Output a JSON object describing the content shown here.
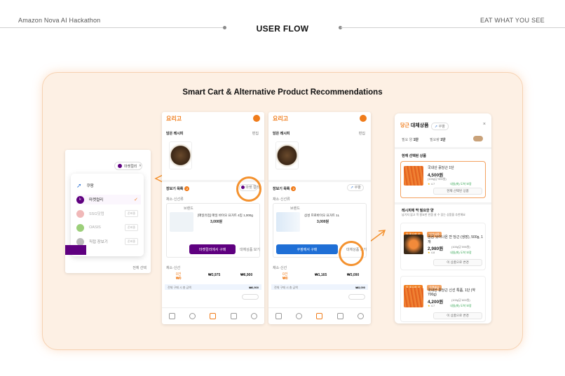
{
  "header": {
    "left": "Amazon Nova AI Hackathon",
    "center": "USER FLOW",
    "right": "EAT WHAT YOU SEE"
  },
  "panel": {
    "title": "Smart Cart & Alternative Product Recommendations"
  },
  "colors": {
    "accent": "#f07c1b",
    "kurly_purple": "#5f0080",
    "blue_cta": "#1f6fd6",
    "panel_bg": "#fdf0e4"
  },
  "dropdown": {
    "button": "마켓컬리",
    "items": [
      {
        "label": "쿠팡",
        "icon": "rocket-icon"
      },
      {
        "label": "마켓컬리",
        "icon": "kurly-logo",
        "selected": true
      },
      {
        "label": "SSG닷컴",
        "tag": "준비중"
      },
      {
        "label": "OASIS",
        "tag": "준비중"
      },
      {
        "label": "직접 장보기",
        "tag": "준비중"
      }
    ],
    "footer": "전체 선택"
  },
  "screen_kurly": {
    "logo": "요리고",
    "recipe_section": "담은 레시피",
    "recipe_edit": "편집",
    "cart_section": "장보기 목록",
    "cart_count": "2",
    "store_chip": "마켓 컬리",
    "cat1": "채소·신선류",
    "prod_brand": "브랜드",
    "prod_name": "[매일유업] 매일 바이오 요거트 4입 1,000g",
    "prod_price": "3,000원",
    "cta": "마켓컬리에서 구매",
    "alt_btn": "대체상품 보기",
    "cat2": "채소·신선",
    "totals": [
      {
        "label": "0건",
        "value": "₩0"
      },
      {
        "label": "",
        "value": "₩3,975"
      },
      {
        "label": "",
        "value": "₩6,900"
      }
    ],
    "info": "전체 구매 시 총 금액",
    "info_val": "₩6,900"
  },
  "screen_coupang": {
    "logo": "요리고",
    "recipe_section": "담은 레시피",
    "recipe_edit": "편집",
    "cart_section": "장보기 목록",
    "cart_count": "2",
    "store_chip": "쿠팡",
    "cat1": "채소·신선류",
    "prod_brand": "브랜드",
    "prod_name": "삼성 프로바이오 요거트 1L",
    "prod_price": "3,000원",
    "cta": "쿠팡에서 구매",
    "alt_btn": "대체상품 보기",
    "cat2": "채소·신선",
    "totals": [
      {
        "label": "0건",
        "value": "₩0"
      },
      {
        "label": "",
        "value": "₩1,165"
      },
      {
        "label": "",
        "value": "₩3,090"
      }
    ],
    "info": "전체 구매 시 총 금액",
    "info_val": "₩3,090"
  },
  "alt_panel": {
    "title_main": "대체상품",
    "title_accent": "당근",
    "store_chip": "쿠팡",
    "meta_need": "필요 양",
    "meta_need_val": "1단",
    "meta_have": "필요량",
    "meta_have_val": "1단",
    "current_section": "현재 선택된 상품",
    "current": {
      "name": "국내산 흙당근 1단",
      "price": "4,500원",
      "unit": "(100g당 900원)",
      "rating": "4.7",
      "delivery": "내일(화) 도착 보장",
      "button": "현재 선택된 상품"
    },
    "recommend_section": "레시피에 딱 필요한 양",
    "recommend_sub": "남기지 않고 딱 필요한 만큼 살 수 있는 상품을 추천해요",
    "products": [
      {
        "tags": [
          "딱 필요한 양",
          "신선식품"
        ],
        "name": "곰곰 씻어나온 깐 당근 (냉장), 500g, 1개",
        "price": "2,980원",
        "unit": "(100g당 596원)",
        "rating": "4.8",
        "delivery": "내일(화) 도착 보장",
        "button": "이 상품으로 변경"
      },
      {
        "tags": [
          "딱 필요한 양",
          "로켓배송"
        ],
        "name": "국내산 흙당근 신선 특품, 1단 (약 700g)",
        "price": "4,200원",
        "unit": "(100g당 600원)",
        "rating": "4.7",
        "delivery": "내일(화) 도착 보장",
        "button": "이 상품으로 변경"
      }
    ]
  }
}
